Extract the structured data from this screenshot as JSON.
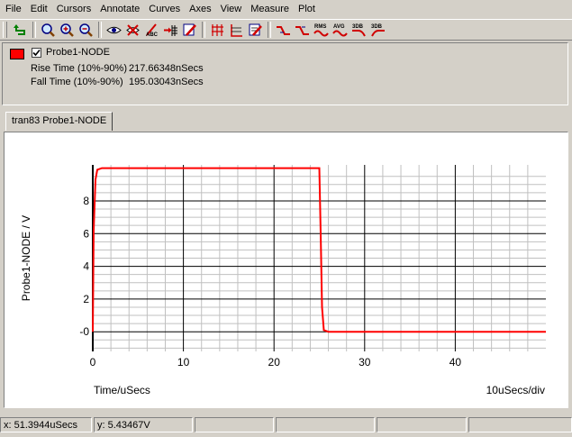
{
  "menu": [
    "File",
    "Edit",
    "Cursors",
    "Annotate",
    "Curves",
    "Axes",
    "View",
    "Measure",
    "Plot"
  ],
  "toolbar": {
    "rms_label": "RMS",
    "avg_label": "AVG",
    "db1_label": "3DB",
    "db2_label": "3DB"
  },
  "legend": {
    "probe_color": "#ff0000",
    "checked": true,
    "probe_name": "Probe1-NODE",
    "measurements": [
      {
        "label": "Rise Time (10%-90%)",
        "value": "217.66348nSecs"
      },
      {
        "label": "Fall Time (10%-90%)",
        "value": "195.03043nSecs"
      }
    ]
  },
  "tab": {
    "label": "tran83 Probe1-NODE"
  },
  "chart_data": {
    "type": "line",
    "xlabel": "Time/uSecs",
    "ylabel": "Probe1-NODE / V",
    "scale_label": "10uSecs/div",
    "xlim": [
      0,
      50
    ],
    "ylim": [
      -1.2,
      10.2
    ],
    "x_ticks": [
      "0",
      "10",
      "20",
      "30",
      "40"
    ],
    "x_tick_values": [
      0,
      10,
      20,
      30,
      40
    ],
    "y_ticks": [
      "-0",
      "2",
      "4",
      "6",
      "8"
    ],
    "y_tick_values": [
      0,
      2,
      4,
      6,
      8
    ],
    "grid": true,
    "line_color": "#ff0000",
    "series": [
      {
        "x": [
          0,
          0.1,
          0.3,
          0.5,
          1.0,
          25.0,
          25.15,
          25.3,
          25.5,
          26.0,
          50.0
        ],
        "y": [
          0,
          6.2,
          9.3,
          9.9,
          10.0,
          10.0,
          6.0,
          1.5,
          0.1,
          0.0,
          0.0
        ]
      }
    ]
  },
  "status": {
    "x_readout": "x: 51.3944uSecs",
    "y_readout": "y: 5.43467V"
  }
}
